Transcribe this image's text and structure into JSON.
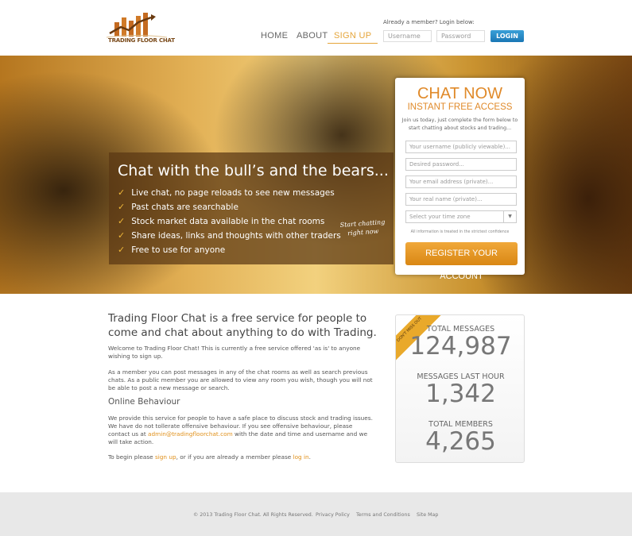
{
  "header": {
    "brand": "TRADING FLOOR CHAT",
    "nav": [
      {
        "label": "HOME"
      },
      {
        "label": "ABOUT"
      },
      {
        "label": "SIGN UP",
        "active": true
      }
    ],
    "login_label": "Already a member? Login below:",
    "username_placeholder": "Username",
    "password_placeholder": "Password",
    "login_button": "LOGIN"
  },
  "hero": {
    "title": "Chat with the bull’s and the bears...",
    "features": [
      "Live chat, no page reloads to see new messages",
      "Past chats are searchable",
      "Stock market data available in the chat rooms",
      "Share ideas, links and thoughts with other traders",
      "Free to use for anyone"
    ],
    "callout_line1": "Start chatting",
    "callout_line2": "right now"
  },
  "signup": {
    "title": "CHAT NOW",
    "subtitle": "INSTANT FREE ACCESS",
    "desc_line1": "Join us today, just complete the form below to",
    "desc_line2": "start chatting about stocks and trading...",
    "fields": [
      "Your username (publicly viewable)...",
      "Desired password...",
      "Your email address (private)...",
      "Your real name (private)..."
    ],
    "timezone": "Select your time zone",
    "confidence": "All information is treated in the strictest confidence",
    "register_button": "REGISTER YOUR ACCOUNT"
  },
  "main": {
    "intro": "Trading Floor Chat is a free service for people to come and chat about anything to do with Trading.",
    "p1": "Welcome to Trading Floor Chat! This is currently a free service offered 'as is' to anyone wishing to sign up.",
    "p2": "As a member you can post messages in any of the chat rooms as well as search previous chats. As a public member you are allowed to view any room you wish, though you will not be able to post a new message or search.",
    "behaviour_heading": "Online Behaviour",
    "p3_before": "We provide this service for people to have a safe place to discuss stock and trading issues. We have do not tollerate offensive behaviour. If you see offensive behaviour, please contact us at ",
    "email": "admin@tradingfloorchat.com",
    "p3_after": " with the date and time and username and we will take action.",
    "p4_before": "To begin please ",
    "signup_link": "sign up",
    "p4_mid": ", or if you are already a member please ",
    "login_link": "log in",
    "p4_after": "."
  },
  "stats": {
    "ribbon": "DON'T MISS OUT",
    "items": [
      {
        "label": "TOTAL MESSAGES",
        "value": "124,987"
      },
      {
        "label": "MESSAGES LAST HOUR",
        "value": "1,342"
      },
      {
        "label": "TOTAL MEMBERS",
        "value": "4,265"
      }
    ]
  },
  "footer": {
    "copyright": "© 2013 Trading Floor Chat. All Rights Reserved.",
    "links": [
      "Privacy Policy",
      "Terms and Conditions",
      "Site Map"
    ]
  },
  "colors": {
    "accent": "#e08a2a",
    "login": "#1a77b5"
  }
}
